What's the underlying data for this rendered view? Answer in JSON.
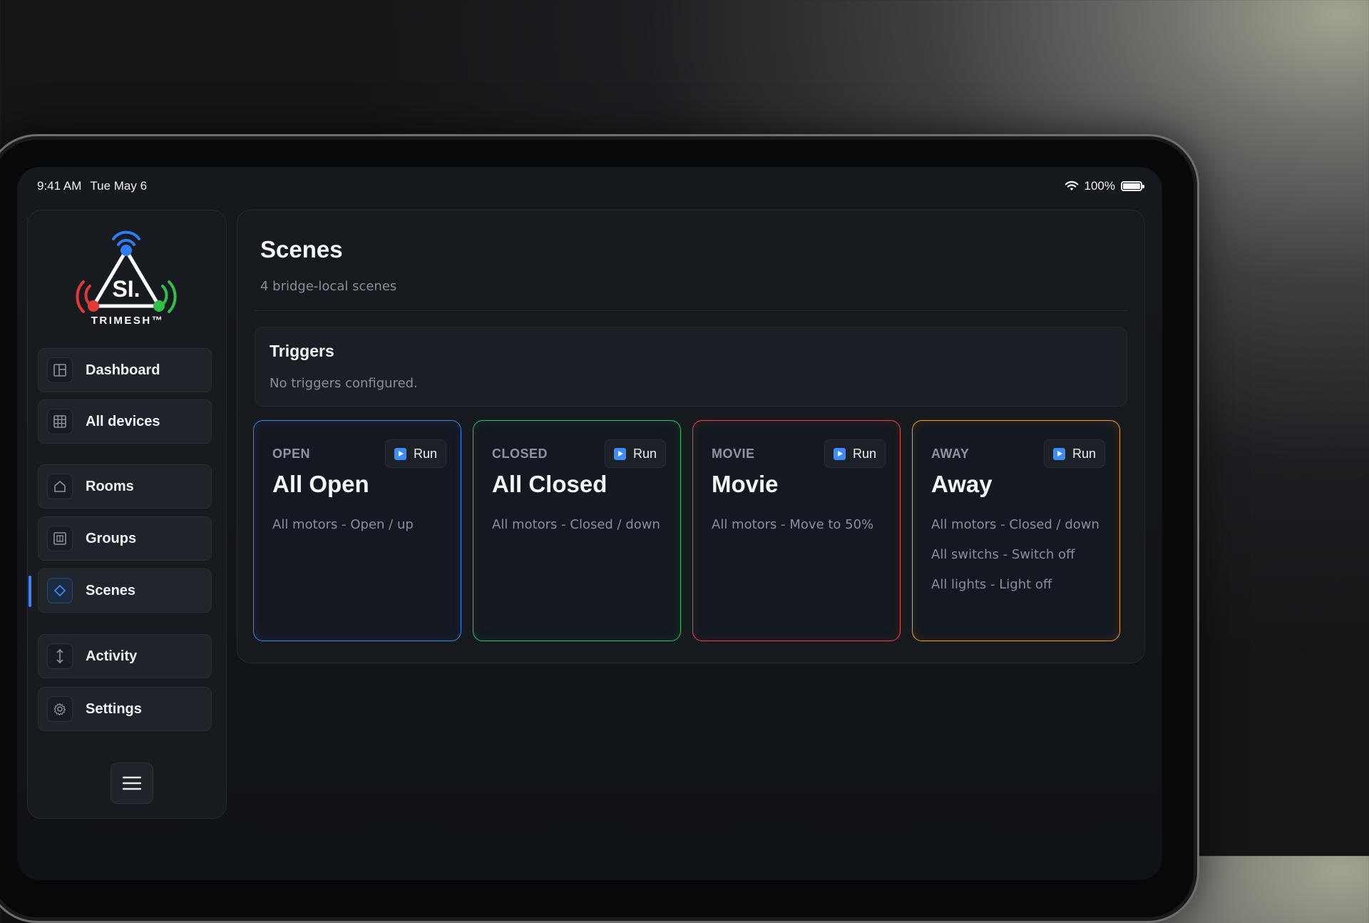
{
  "status_bar": {
    "time": "9:41 AM",
    "date": "Tue May 6",
    "battery": "100%",
    "battery_level": 1.0
  },
  "brand": {
    "logo_text": "SI.",
    "logo_subtext": "TRIMESH™"
  },
  "sidebar": {
    "items": [
      {
        "label": "Dashboard",
        "icon": "layout-icon"
      },
      {
        "label": "All devices",
        "icon": "grid-icon"
      },
      {
        "label": "Rooms",
        "icon": "home-icon"
      },
      {
        "label": "Groups",
        "icon": "layers-icon"
      },
      {
        "label": "Scenes",
        "icon": "diamond-icon",
        "active": true
      },
      {
        "label": "Activity",
        "icon": "updown-icon"
      },
      {
        "label": "Settings",
        "icon": "gear-icon"
      }
    ],
    "menu_icon": "hamburger-icon"
  },
  "page": {
    "title": "Scenes",
    "subtitle": "4 bridge-local scenes"
  },
  "triggers": {
    "title": "Triggers",
    "empty_text": "No triggers configured."
  },
  "run_label": "Run",
  "scenes": [
    {
      "kicker": "OPEN",
      "name": "All Open",
      "color": "#3b82f6",
      "actions": [
        "All motors - Open / up"
      ]
    },
    {
      "kicker": "CLOSED",
      "name": "All Closed",
      "color": "#22c55e",
      "actions": [
        "All motors - Closed / down"
      ]
    },
    {
      "kicker": "MOVIE",
      "name": "Movie",
      "color": "#ef4444",
      "actions": [
        "All motors - Move to 50%"
      ]
    },
    {
      "kicker": "AWAY",
      "name": "Away",
      "color": "#f59e0b",
      "actions": [
        "All motors - Closed / down",
        "All switchs - Switch off",
        "All lights - Light off"
      ]
    }
  ]
}
